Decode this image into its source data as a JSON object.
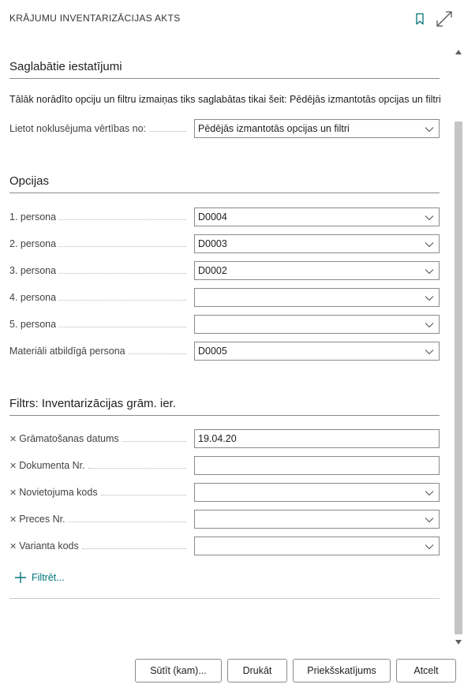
{
  "window": {
    "title": "KRĀJUMU INVENTARIZĀCIJAS AKTS"
  },
  "saved_settings": {
    "title": "Saglabātie iestatījumi",
    "info": "Tālāk norādīto opciju un filtru izmaiņas tiks saglabātas tikai šeit: Pēdējās izmantotās opcijas un filtri",
    "default_label": "Lietot noklusējuma vērtības no:",
    "default_value": "Pēdējās izmantotās opcijas un filtri"
  },
  "options": {
    "title": "Opcijas",
    "fields": [
      {
        "label": "1. persona",
        "value": "D0004"
      },
      {
        "label": "2. persona",
        "value": "D0003"
      },
      {
        "label": "3. persona",
        "value": "D0002"
      },
      {
        "label": "4. persona",
        "value": ""
      },
      {
        "label": "5. persona",
        "value": ""
      },
      {
        "label": "Materiāli atbildīgā persona",
        "value": "D0005"
      }
    ]
  },
  "filters": {
    "title": "Filtrs: Inventarizācijas grām. ier.",
    "fields": [
      {
        "label": "Grāmatošanas datums",
        "value": "19.04.20"
      },
      {
        "label": "Dokumenta Nr.",
        "value": ""
      },
      {
        "label": "Novietojuma kods",
        "value": ""
      },
      {
        "label": "Preces Nr.",
        "value": ""
      },
      {
        "label": "Varianta kods",
        "value": ""
      }
    ],
    "add_label": "Filtrēt..."
  },
  "buttons": {
    "send": "Sūtīt (kam)...",
    "print": "Drukāt",
    "preview": "Priekšskatījums",
    "cancel": "Atcelt"
  },
  "colors": {
    "accent": "#00757a",
    "border": "#8a8a8a",
    "scroll_thumb": "#c4c4c4"
  }
}
